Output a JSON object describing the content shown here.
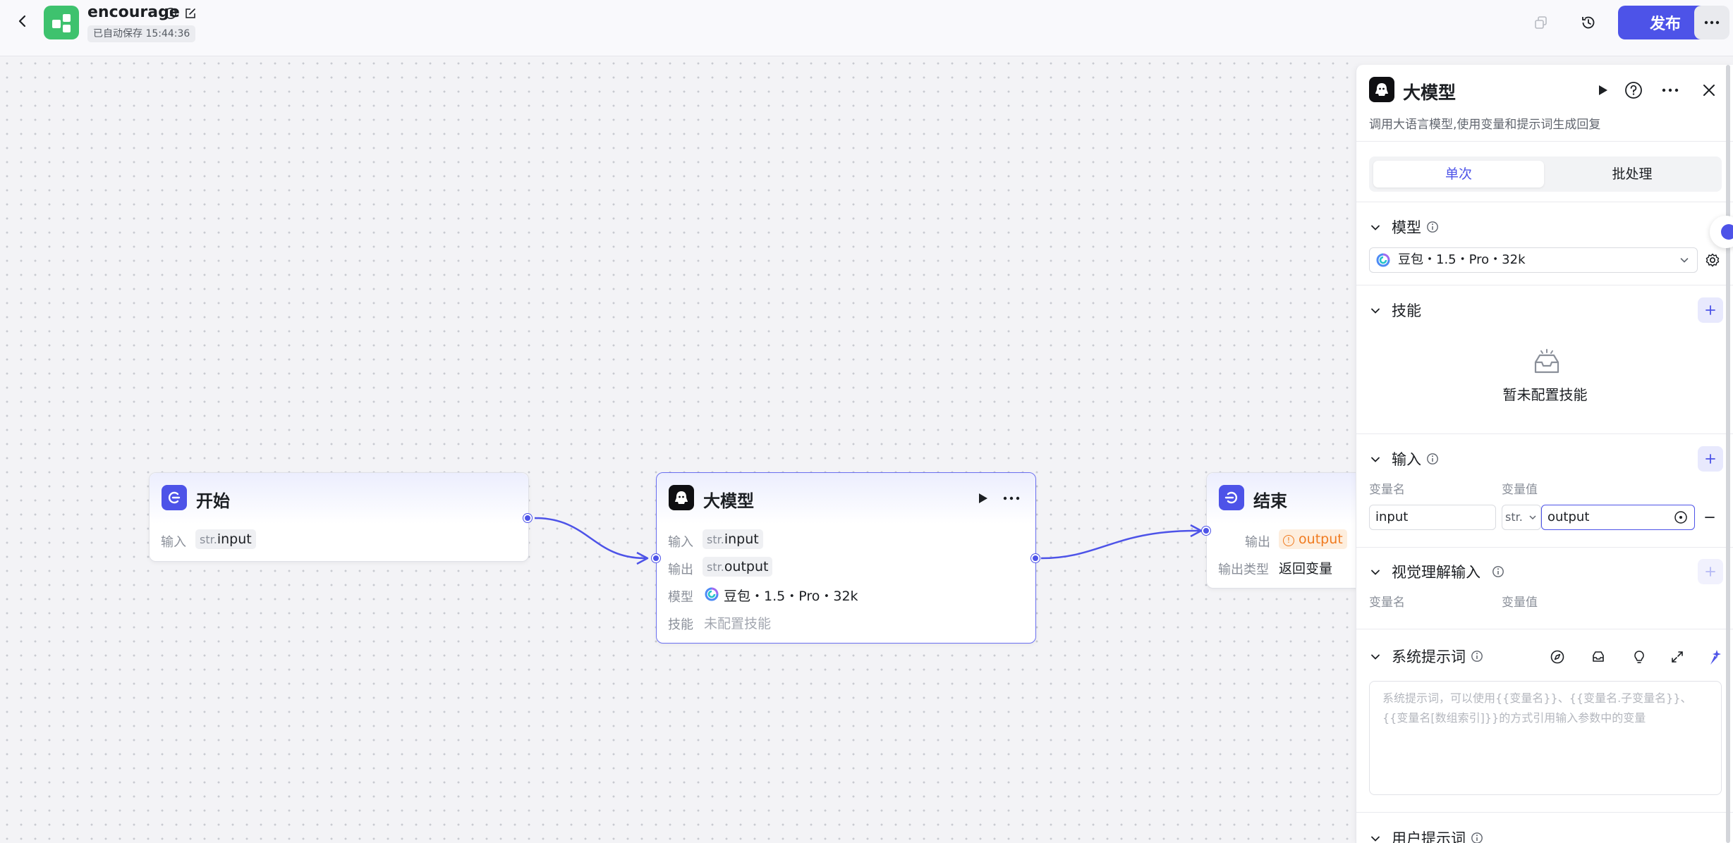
{
  "header": {
    "app_name": "encourage",
    "autosave": "已自动保存 15:44:36",
    "publish_label": "发布"
  },
  "colors": {
    "accent": "#4d53e8",
    "logo": "#3ec26e",
    "warning": "#f07a1f"
  },
  "nodes": {
    "start": {
      "title": "开始",
      "input_label": "输入",
      "input_prefix": "str.",
      "input_value": "input"
    },
    "llm": {
      "title": "大模型",
      "input_label": "输入",
      "input_prefix": "str.",
      "input_value": "input",
      "output_label": "输出",
      "output_prefix": "str.",
      "output_value": "output",
      "model_label": "模型",
      "model_value": "豆包・1.5・Pro・32k",
      "skill_label": "技能",
      "skill_value": "未配置技能"
    },
    "end": {
      "title": "结束",
      "output_label": "输出",
      "output_value": "output",
      "type_label": "输出类型",
      "type_value": "返回变量"
    }
  },
  "panel": {
    "title": "大模型",
    "description": "调用大语言模型,使用变量和提示词生成回复",
    "tabs": [
      {
        "label": "单次"
      },
      {
        "label": "批处理"
      }
    ],
    "model": {
      "section_title": "模型",
      "selected": "豆包・1.5・Pro・32k"
    },
    "skills": {
      "section_title": "技能",
      "empty_text": "暂未配置技能"
    },
    "inputs": {
      "section_title": "输入",
      "col_name": "变量名",
      "col_value": "变量值",
      "rows": [
        {
          "name": "input",
          "type": "str.",
          "value": "output"
        }
      ]
    },
    "vision": {
      "section_title": "视觉理解输入",
      "col_name": "变量名",
      "col_value": "变量值"
    },
    "system_prompt": {
      "section_title": "系统提示词",
      "placeholder_line1": "系统提示词，可以使用{{变量名}}、{{变量名.子变量名}}、",
      "placeholder_line2": "{{变量名[数组索引]}}的方式引用输入参数中的变量"
    },
    "user_prompt": {
      "section_title": "用户提示词"
    }
  }
}
